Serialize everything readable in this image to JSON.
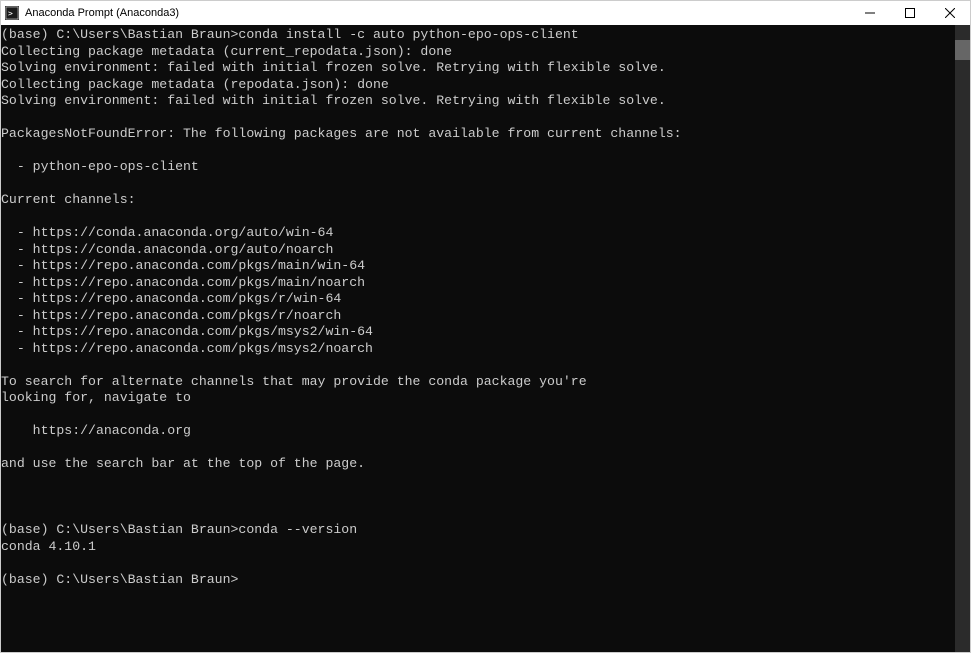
{
  "window": {
    "title": "Anaconda Prompt (Anaconda3)"
  },
  "terminal": {
    "lines": [
      "(base) C:\\Users\\Bastian Braun>conda install -c auto python-epo-ops-client",
      "Collecting package metadata (current_repodata.json): done",
      "Solving environment: failed with initial frozen solve. Retrying with flexible solve.",
      "Collecting package metadata (repodata.json): done",
      "Solving environment: failed with initial frozen solve. Retrying with flexible solve.",
      "",
      "PackagesNotFoundError: The following packages are not available from current channels:",
      "",
      "  - python-epo-ops-client",
      "",
      "Current channels:",
      "",
      "  - https://conda.anaconda.org/auto/win-64",
      "  - https://conda.anaconda.org/auto/noarch",
      "  - https://repo.anaconda.com/pkgs/main/win-64",
      "  - https://repo.anaconda.com/pkgs/main/noarch",
      "  - https://repo.anaconda.com/pkgs/r/win-64",
      "  - https://repo.anaconda.com/pkgs/r/noarch",
      "  - https://repo.anaconda.com/pkgs/msys2/win-64",
      "  - https://repo.anaconda.com/pkgs/msys2/noarch",
      "",
      "To search for alternate channels that may provide the conda package you're",
      "looking for, navigate to",
      "",
      "    https://anaconda.org",
      "",
      "and use the search bar at the top of the page.",
      "",
      "",
      "",
      "(base) C:\\Users\\Bastian Braun>conda --version",
      "conda 4.10.1",
      "",
      "(base) C:\\Users\\Bastian Braun>"
    ]
  }
}
